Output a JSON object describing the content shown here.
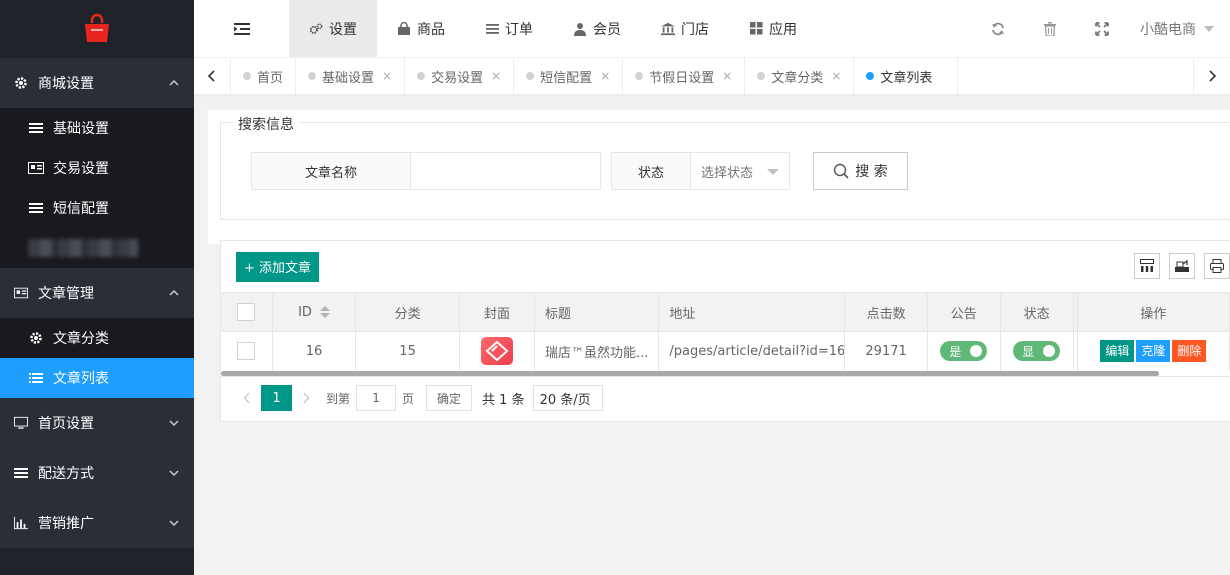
{
  "sidebar": {
    "logo_icon": "shopping-bag-icon",
    "groups": [
      {
        "label": "商城设置",
        "icon": "gear-icon",
        "expanded": true
      },
      {
        "label": "文章管理",
        "icon": "id-card-icon",
        "expanded": true
      },
      {
        "label": "首页设置",
        "icon": "monitor-icon",
        "expanded": false
      },
      {
        "label": "配送方式",
        "icon": "list-icon",
        "expanded": false
      },
      {
        "label": "营销推广",
        "icon": "bar-chart-icon",
        "expanded": false
      }
    ],
    "shop_items": [
      {
        "label": "基础设置",
        "icon": "list-icon"
      },
      {
        "label": "交易设置",
        "icon": "id-card-icon"
      },
      {
        "label": "短信配置",
        "icon": "list-icon"
      }
    ],
    "article_items": [
      {
        "label": "文章分类",
        "icon": "gear-icon",
        "active": false
      },
      {
        "label": "文章列表",
        "icon": "list-icon",
        "active": true
      }
    ]
  },
  "topbar": {
    "nav": [
      {
        "label": "设置",
        "icon": "gears-icon",
        "active": true
      },
      {
        "label": "商品",
        "icon": "bag-icon",
        "active": false
      },
      {
        "label": "订单",
        "icon": "list-icon",
        "active": false
      },
      {
        "label": "会员",
        "icon": "user-icon",
        "active": false
      },
      {
        "label": "门店",
        "icon": "bank-icon",
        "active": false
      },
      {
        "label": "应用",
        "icon": "grid-icon",
        "active": false
      }
    ],
    "user_name": "小酷电商"
  },
  "tabs": [
    {
      "label": "首页",
      "closable": false,
      "active": false
    },
    {
      "label": "基础设置",
      "closable": true,
      "active": false
    },
    {
      "label": "交易设置",
      "closable": true,
      "active": false
    },
    {
      "label": "短信配置",
      "closable": true,
      "active": false
    },
    {
      "label": "节假日设置",
      "closable": true,
      "active": false
    },
    {
      "label": "文章分类",
      "closable": true,
      "active": false
    },
    {
      "label": "文章列表",
      "closable": false,
      "active": true
    }
  ],
  "tab_close_glyph": "×",
  "search": {
    "legend": "搜索信息",
    "name_label": "文章名称",
    "name_value": "",
    "status_label": "状态",
    "status_placeholder": "选择状态",
    "search_button": "搜 索"
  },
  "table": {
    "add_button": "+ 添加文章",
    "columns": [
      "ID",
      "分类",
      "封面",
      "标题",
      "地址",
      "点击数",
      "公告",
      "状态",
      "操作"
    ],
    "rows": [
      {
        "id": "16",
        "category": "15",
        "title": "瑞店™虽然功能...",
        "address": "/pages/article/detail?id=16",
        "clicks": "29171",
        "notice": "是",
        "status": "显",
        "actions": [
          "编辑",
          "克隆",
          "删除"
        ]
      }
    ]
  },
  "pager": {
    "current": "1",
    "goto_label": "到第",
    "goto_value": "1",
    "page_unit": "页",
    "confirm": "确定",
    "total": "共 1 条",
    "size": "20 条/页"
  },
  "colors": {
    "sidebar_bg": "#20222a",
    "active_blue": "#1e9fff",
    "primary_green": "#009688",
    "switch_green": "#5fb878",
    "danger": "#ff5722"
  }
}
